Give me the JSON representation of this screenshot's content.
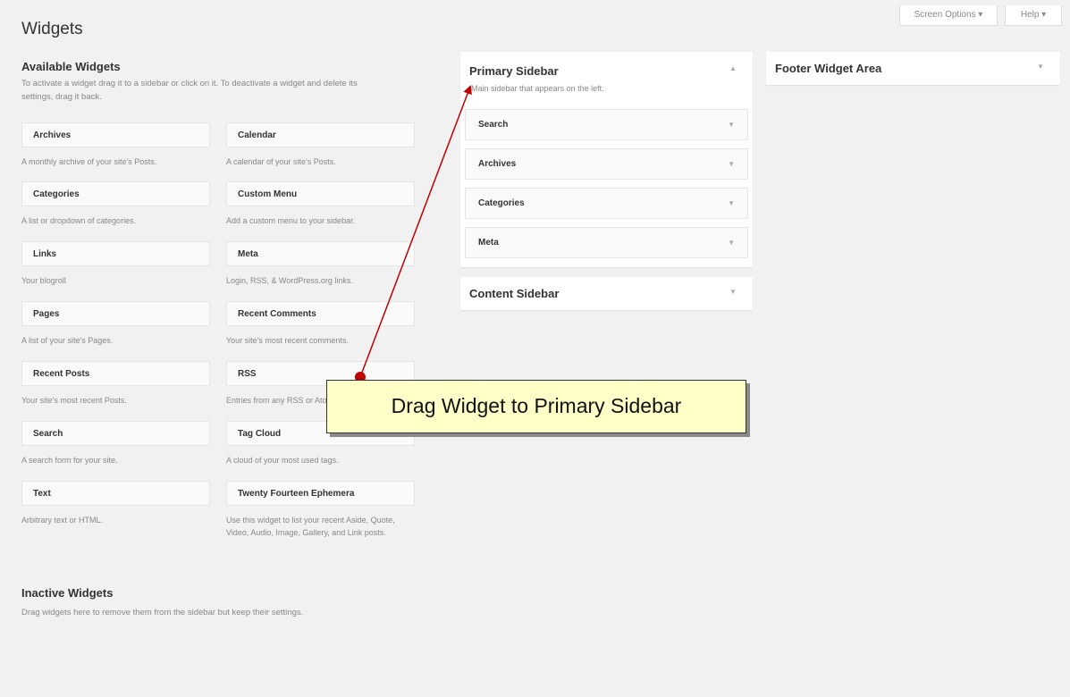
{
  "page_title": "Widgets",
  "top_buttons": {
    "screen_options": "Screen Options ▾",
    "help": "Help ▾"
  },
  "available": {
    "heading": "Available Widgets",
    "description_line1": "To activate a widget drag it to a sidebar or click on it. To deactivate a widget and delete its",
    "description_line2": "settings, drag it back.",
    "widgets": [
      {
        "title": "Archives",
        "desc": "A monthly archive of your site's Posts."
      },
      {
        "title": "Calendar",
        "desc": "A calendar of your site's Posts."
      },
      {
        "title": "Categories",
        "desc": "A list or dropdown of categories."
      },
      {
        "title": "Custom Menu",
        "desc": "Add a custom menu to your sidebar."
      },
      {
        "title": "Links",
        "desc": "Your blogroll"
      },
      {
        "title": "Meta",
        "desc": "Login, RSS, & WordPress.org links."
      },
      {
        "title": "Pages",
        "desc": "A list of your site's Pages."
      },
      {
        "title": "Recent Comments",
        "desc": "Your site's most recent comments."
      },
      {
        "title": "Recent Posts",
        "desc": "Your site's most recent Posts."
      },
      {
        "title": "RSS",
        "desc": "Entries from any RSS or Atom feed."
      },
      {
        "title": "Search",
        "desc": "A search form for your site."
      },
      {
        "title": "Tag Cloud",
        "desc": "A cloud of your most used tags."
      },
      {
        "title": "Text",
        "desc": "Arbitrary text or HTML."
      },
      {
        "title": "Twenty Fourteen Ephemera",
        "desc": "Use this widget to list your recent Aside, Quote, Video, Audio, Image, Gallery, and Link posts."
      }
    ]
  },
  "inactive": {
    "heading": "Inactive Widgets",
    "description": "Drag widgets here to remove them from the sidebar but keep their settings."
  },
  "primary_sidebar": {
    "title": "Primary Sidebar",
    "description": "Main sidebar that appears on the left.",
    "widgets": [
      "Search",
      "Archives",
      "Categories",
      "Meta"
    ]
  },
  "content_sidebar": {
    "title": "Content Sidebar"
  },
  "footer_area": {
    "title": "Footer Widget Area"
  },
  "callout": {
    "text": "Drag Widget to Primary Sidebar"
  },
  "colors": {
    "arrow": "#c00000",
    "callout_bg": "#ffffc8",
    "page_bg": "#f1f1f1"
  }
}
